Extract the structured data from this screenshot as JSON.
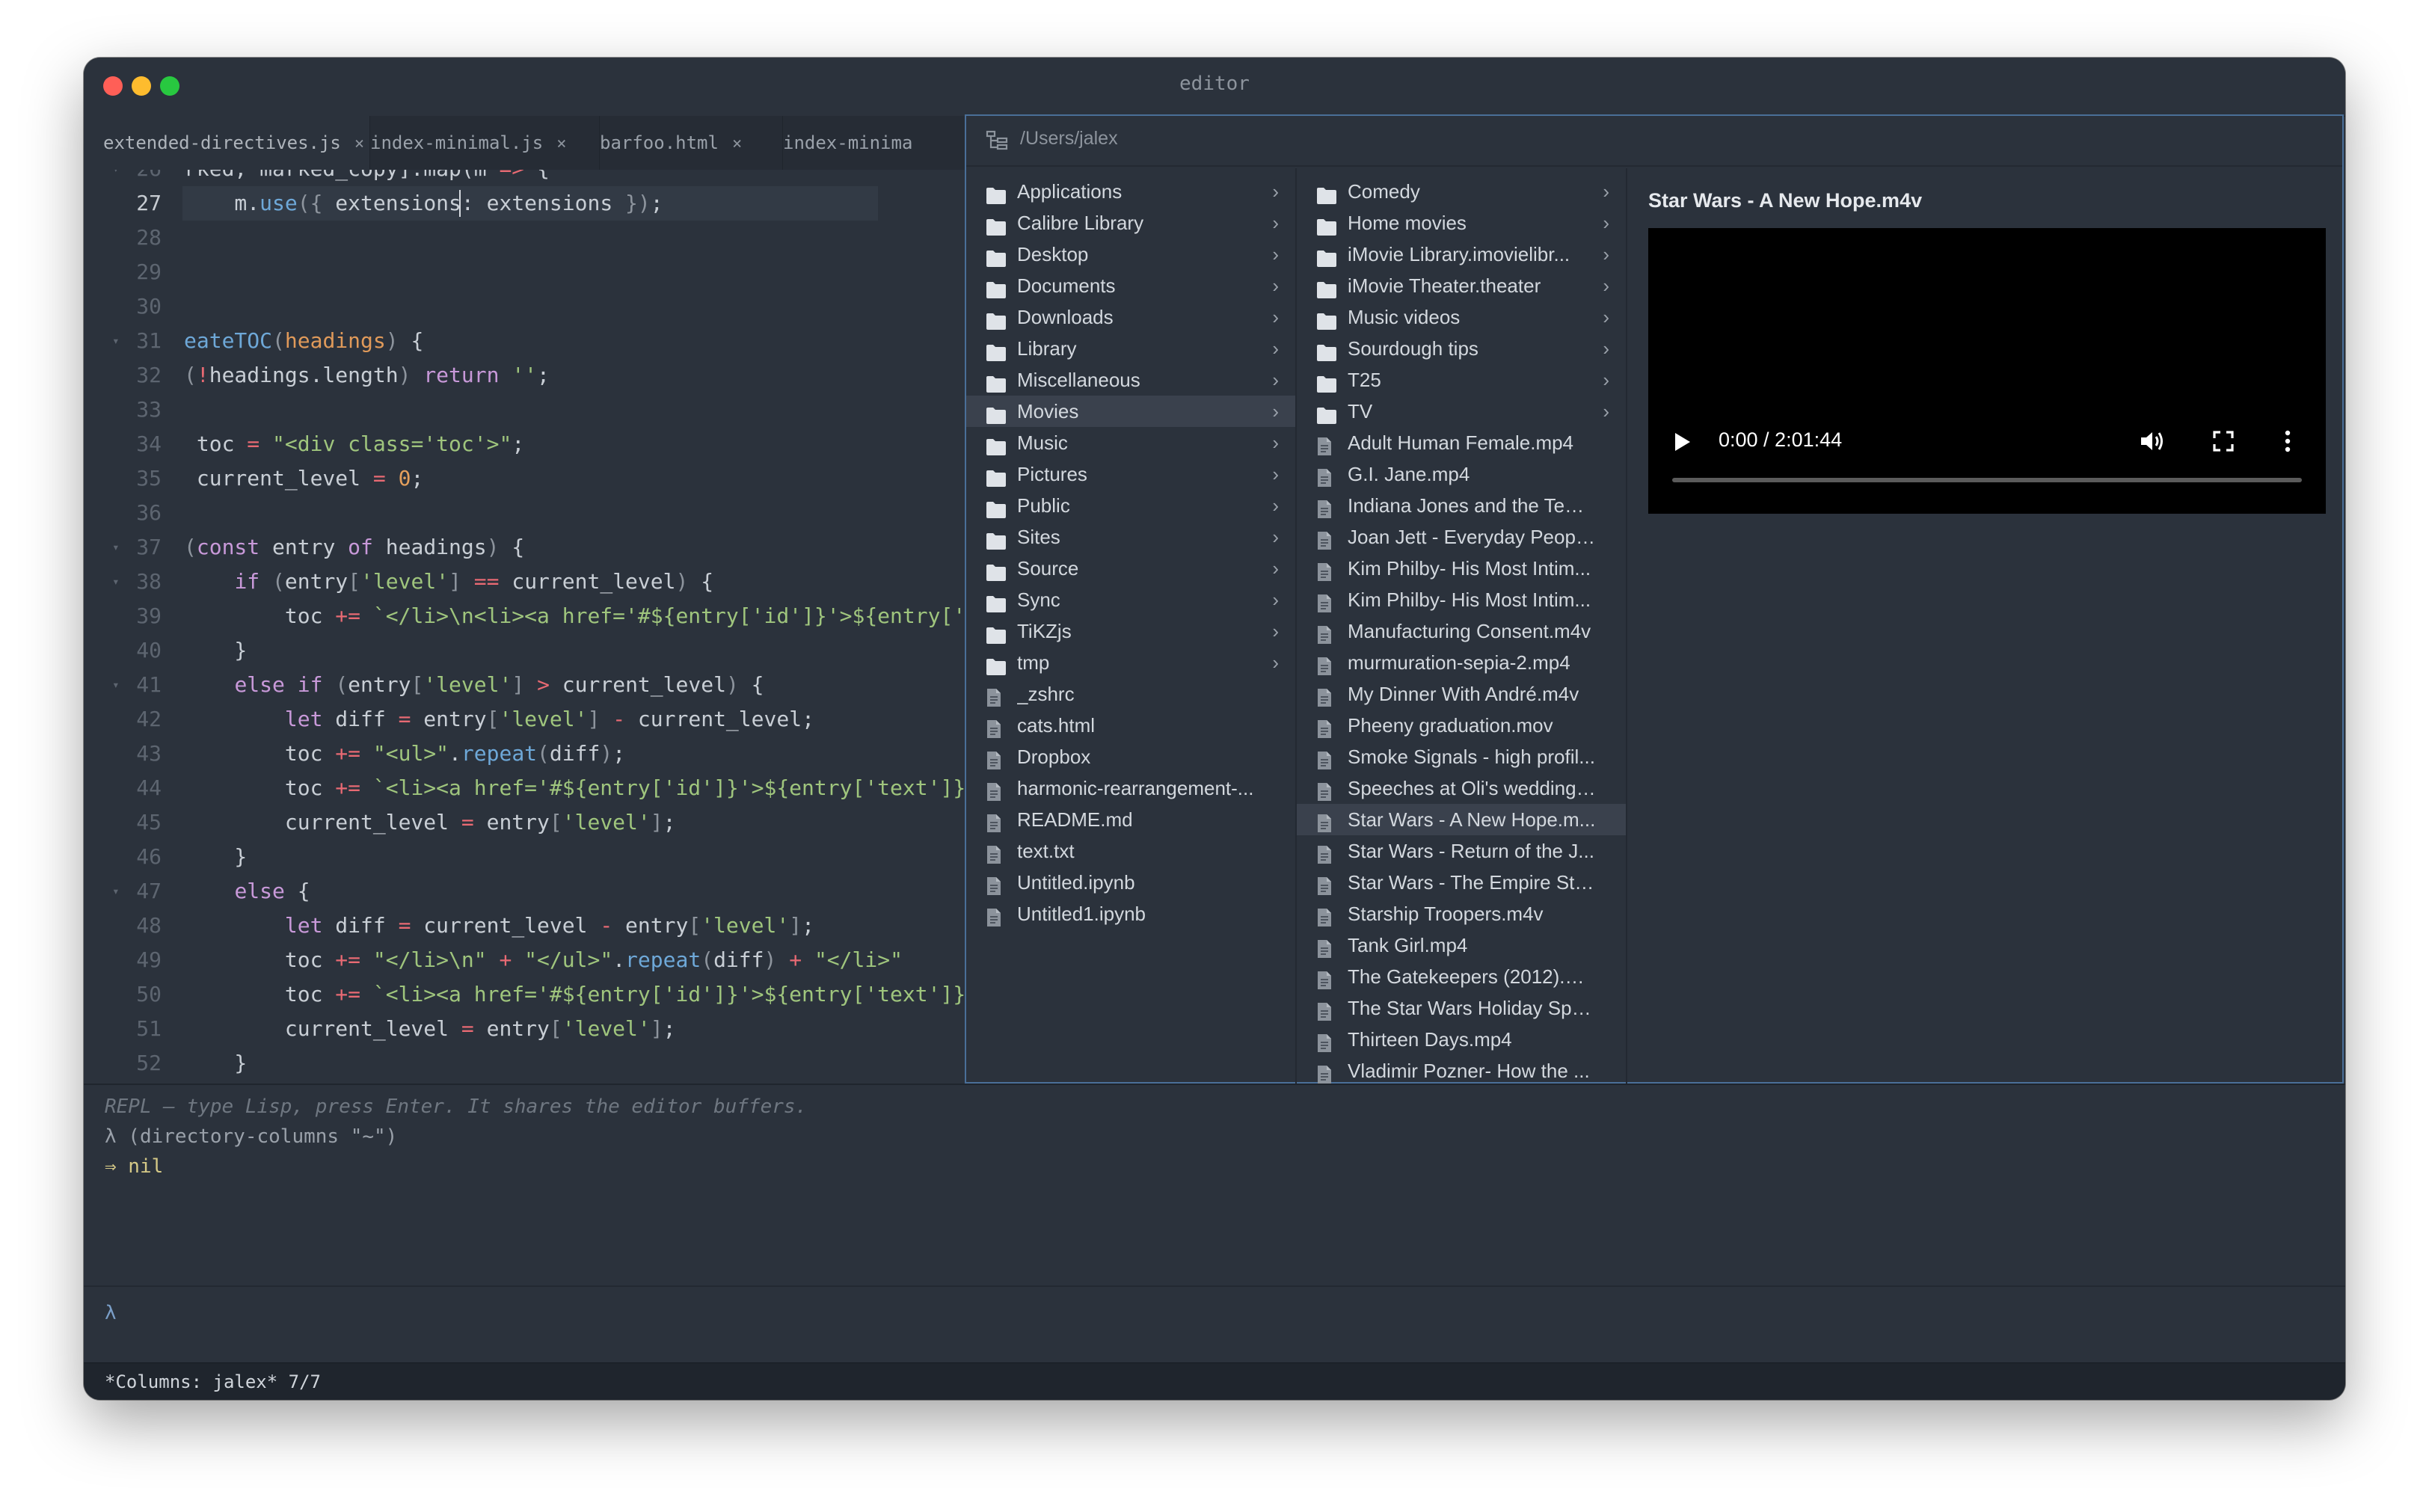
{
  "window": {
    "title": "editor"
  },
  "tabs": [
    {
      "label": "extended-directives.js",
      "close": "×"
    },
    {
      "label": "index-minimal.js",
      "close": "×"
    },
    {
      "label": "barfoo.html",
      "close": "×"
    },
    {
      "label": "index-minima",
      "close": ""
    }
  ],
  "editor": {
    "current_line": "27",
    "lines": [
      {
        "n": "26",
        "fold": true,
        "html": "rked, marked_copy].map(m <span class='c-op'>=&gt;</span> {"
      },
      {
        "n": "27",
        "fold": false,
        "html": "    m.<span class='c-fn'>use</span><span class='c-pun'>({</span> extensions: extensions <span class='c-pun'>})</span>;"
      },
      {
        "n": "28",
        "fold": false,
        "html": ""
      },
      {
        "n": "29",
        "fold": false,
        "html": ""
      },
      {
        "n": "30",
        "fold": false,
        "html": ""
      },
      {
        "n": "31",
        "fold": true,
        "html": "<span class='c-fn'>eateTOC</span><span class='c-pun'>(</span><span class='c-p'>headings</span><span class='c-pun'>)</span> {"
      },
      {
        "n": "32",
        "fold": false,
        "html": "<span class='c-pun'>(</span><span class='c-op'>!</span>headings.length<span class='c-pun'>)</span> <span class='c-kw'>return</span> <span class='c-str'>''</span>;"
      },
      {
        "n": "33",
        "fold": false,
        "html": ""
      },
      {
        "n": "34",
        "fold": false,
        "html": " toc <span class='c-op'>=</span> <span class='c-str'>\"&lt;div class='toc'&gt;\"</span>;"
      },
      {
        "n": "35",
        "fold": false,
        "html": " current_level <span class='c-op'>=</span> <span class='c-num'>0</span>;"
      },
      {
        "n": "36",
        "fold": false,
        "html": ""
      },
      {
        "n": "37",
        "fold": true,
        "html": "<span class='c-pun'>(</span><span class='c-kw'>const</span> entry <span class='c-kw'>of</span> headings<span class='c-pun'>)</span> {"
      },
      {
        "n": "38",
        "fold": true,
        "html": "    <span class='c-kw'>if</span> <span class='c-pun'>(</span>entry<span class='c-pun'>[</span><span class='c-str'>'level'</span><span class='c-pun'>]</span> <span class='c-op'>==</span> current_level<span class='c-pun'>)</span> {"
      },
      {
        "n": "39",
        "fold": false,
        "html": "        toc <span class='c-op'>+=</span> <span class='c-str'>`&lt;/li&gt;\\n&lt;li&gt;&lt;a href='#${entry['id']}'&gt;${entry['text']}</span>"
      },
      {
        "n": "40",
        "fold": false,
        "html": "    }"
      },
      {
        "n": "41",
        "fold": true,
        "html": "    <span class='c-kw'>else if</span> <span class='c-pun'>(</span>entry<span class='c-pun'>[</span><span class='c-str'>'level'</span><span class='c-pun'>]</span> <span class='c-op'>&gt;</span> current_level<span class='c-pun'>)</span> {"
      },
      {
        "n": "42",
        "fold": false,
        "html": "        <span class='c-kw'>let</span> diff <span class='c-op'>=</span> entry<span class='c-pun'>[</span><span class='c-str'>'level'</span><span class='c-pun'>]</span> <span class='c-op'>-</span> current_level;"
      },
      {
        "n": "43",
        "fold": false,
        "html": "        toc <span class='c-op'>+=</span> <span class='c-str'>\"&lt;ul&gt;\"</span>.<span class='c-fn'>repeat</span><span class='c-pun'>(</span>diff<span class='c-pun'>)</span>;"
      },
      {
        "n": "44",
        "fold": false,
        "html": "        toc <span class='c-op'>+=</span> <span class='c-str'>`&lt;li&gt;&lt;a href='#${entry['id']}'&gt;${entry['text']}</span>"
      },
      {
        "n": "45",
        "fold": false,
        "html": "        current_level <span class='c-op'>=</span> entry<span class='c-pun'>[</span><span class='c-str'>'level'</span><span class='c-pun'>]</span>;"
      },
      {
        "n": "46",
        "fold": false,
        "html": "    }"
      },
      {
        "n": "47",
        "fold": true,
        "html": "    <span class='c-kw'>else</span> {"
      },
      {
        "n": "48",
        "fold": false,
        "html": "        <span class='c-kw'>let</span> diff <span class='c-op'>=</span> current_level <span class='c-op'>-</span> entry<span class='c-pun'>[</span><span class='c-str'>'level'</span><span class='c-pun'>]</span>;"
      },
      {
        "n": "49",
        "fold": false,
        "html": "        toc <span class='c-op'>+=</span> <span class='c-str'>\"&lt;/li&gt;\\n\"</span> <span class='c-op'>+</span> <span class='c-str'>\"&lt;/ul&gt;\"</span>.<span class='c-fn'>repeat</span><span class='c-pun'>(</span>diff<span class='c-pun'>)</span> <span class='c-op'>+</span> <span class='c-str'>\"&lt;/li&gt;\"</span>"
      },
      {
        "n": "50",
        "fold": false,
        "html": "        toc <span class='c-op'>+=</span> <span class='c-str'>`&lt;li&gt;&lt;a href='#${entry['id']}'&gt;${entry['text']}</span>"
      },
      {
        "n": "51",
        "fold": false,
        "html": "        current_level <span class='c-op'>=</span> entry<span class='c-pun'>[</span><span class='c-str'>'level'</span><span class='c-pun'>]</span>;"
      },
      {
        "n": "52",
        "fold": false,
        "html": "    }"
      }
    ]
  },
  "file_browser": {
    "path": "/Users/jalex",
    "column1": [
      {
        "name": "Applications",
        "type": "folder"
      },
      {
        "name": "Calibre Library",
        "type": "folder"
      },
      {
        "name": "Desktop",
        "type": "folder"
      },
      {
        "name": "Documents",
        "type": "folder"
      },
      {
        "name": "Downloads",
        "type": "folder"
      },
      {
        "name": "Library",
        "type": "folder"
      },
      {
        "name": "Miscellaneous",
        "type": "folder"
      },
      {
        "name": "Movies",
        "type": "folder",
        "selected": true
      },
      {
        "name": "Music",
        "type": "folder"
      },
      {
        "name": "Pictures",
        "type": "folder"
      },
      {
        "name": "Public",
        "type": "folder"
      },
      {
        "name": "Sites",
        "type": "folder"
      },
      {
        "name": "Source",
        "type": "folder"
      },
      {
        "name": "Sync",
        "type": "folder"
      },
      {
        "name": "TiKZjs",
        "type": "folder"
      },
      {
        "name": "tmp",
        "type": "folder"
      },
      {
        "name": "_zshrc",
        "type": "file"
      },
      {
        "name": "cats.html",
        "type": "file"
      },
      {
        "name": "Dropbox",
        "type": "file"
      },
      {
        "name": "harmonic-rearrangement-...",
        "type": "file"
      },
      {
        "name": "README.md",
        "type": "file"
      },
      {
        "name": "text.txt",
        "type": "file"
      },
      {
        "name": "Untitled.ipynb",
        "type": "file"
      },
      {
        "name": "Untitled1.ipynb",
        "type": "file"
      }
    ],
    "column2": [
      {
        "name": "Comedy",
        "type": "folder"
      },
      {
        "name": "Home movies",
        "type": "folder"
      },
      {
        "name": "iMovie Library.imovielibr...",
        "type": "folder"
      },
      {
        "name": "iMovie Theater.theater",
        "type": "folder"
      },
      {
        "name": "Music videos",
        "type": "folder"
      },
      {
        "name": "Sourdough tips",
        "type": "folder"
      },
      {
        "name": "T25",
        "type": "folder"
      },
      {
        "name": "TV",
        "type": "folder"
      },
      {
        "name": "Adult Human Female.mp4",
        "type": "file"
      },
      {
        "name": "G.I. Jane.mp4",
        "type": "file"
      },
      {
        "name": "Indiana Jones and the Tem...",
        "type": "file"
      },
      {
        "name": "Joan Jett - Everyday Peopl...",
        "type": "file"
      },
      {
        "name": "Kim Philby- His Most Intim...",
        "type": "file"
      },
      {
        "name": "Kim Philby- His Most Intim...",
        "type": "file"
      },
      {
        "name": "Manufacturing Consent.m4v",
        "type": "file"
      },
      {
        "name": "murmuration-sepia-2.mp4",
        "type": "file"
      },
      {
        "name": "My Dinner With André.m4v",
        "type": "file"
      },
      {
        "name": "Pheeny graduation.mov",
        "type": "file"
      },
      {
        "name": "Smoke Signals - high profil...",
        "type": "file"
      },
      {
        "name": "Speeches at Oli's wedding....",
        "type": "file"
      },
      {
        "name": "Star Wars - A New Hope.m...",
        "type": "file",
        "selected": true
      },
      {
        "name": "Star Wars - Return of the J...",
        "type": "file"
      },
      {
        "name": "Star Wars - The Empire Str...",
        "type": "file"
      },
      {
        "name": "Starship Troopers.m4v",
        "type": "file"
      },
      {
        "name": "Tank Girl.mp4",
        "type": "file"
      },
      {
        "name": "The Gatekeepers (2012).m...",
        "type": "file"
      },
      {
        "name": "The Star Wars Holiday Spe...",
        "type": "file"
      },
      {
        "name": "Thirteen Days.mp4",
        "type": "file"
      },
      {
        "name": "Vladimir Pozner- How the ...",
        "type": "file"
      }
    ],
    "chevron": "›",
    "preview": {
      "title": "Star Wars - A New Hope.m4v",
      "time": "0:00 / 2:01:44",
      "progress": 0
    }
  },
  "repl": {
    "hint": "REPL — type Lisp, press Enter. It shares the editor buffers.",
    "input": "λ (directory-columns \"~\")",
    "output": "⇒ nil",
    "prompt": "λ"
  },
  "status": {
    "text": "*Columns: jalex* 7/7"
  }
}
